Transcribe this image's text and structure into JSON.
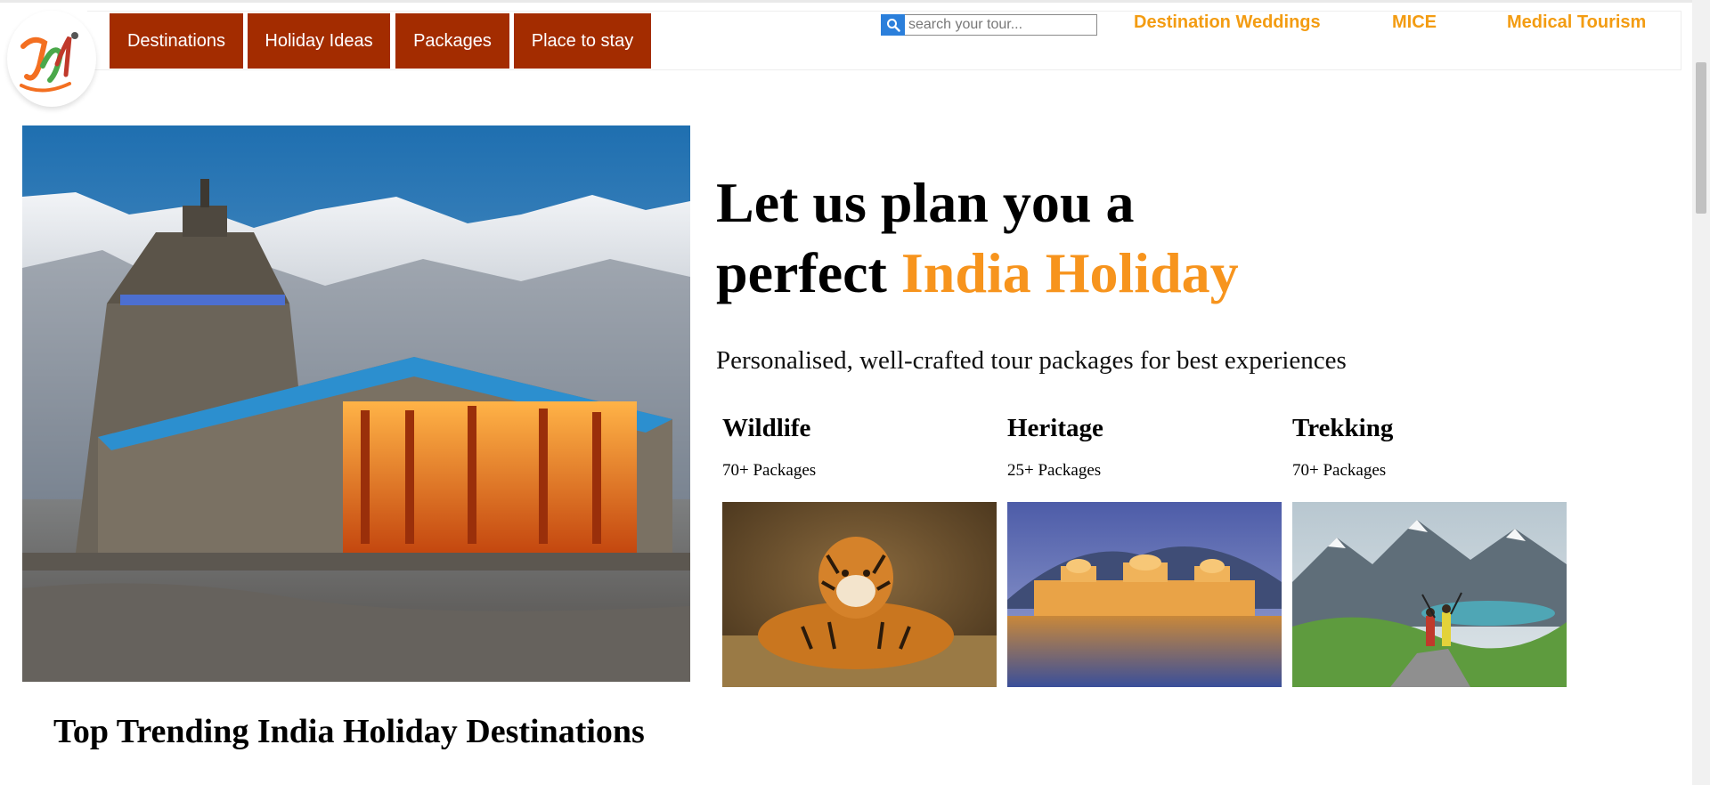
{
  "header": {
    "nav": [
      "Destinations",
      "Holiday Ideas",
      "Packages",
      "Place to stay"
    ],
    "search": {
      "placeholder": "search your tour..."
    },
    "links": [
      "Destination Weddings",
      "MICE",
      "Medical Tourism"
    ]
  },
  "hero": {
    "title_line1": "Let us plan you a",
    "title_line2_prefix": "perfect",
    "title_line2_accent": "India Holiday",
    "subtitle": "Personalised, well-crafted tour packages for best experiences"
  },
  "categories": [
    {
      "name": "Wildlife",
      "count": "70+ Packages"
    },
    {
      "name": "Heritage",
      "count": "25+ Packages"
    },
    {
      "name": "Trekking",
      "count": "70+ Packages"
    }
  ],
  "trending": {
    "title": "Top Trending India Holiday Destinations"
  },
  "colors": {
    "nav_bg": "#a32c00",
    "accent": "#f7941d",
    "link": "#f39c12",
    "search_btn": "#2b7fdb"
  },
  "icons": {
    "search": "search-icon"
  }
}
